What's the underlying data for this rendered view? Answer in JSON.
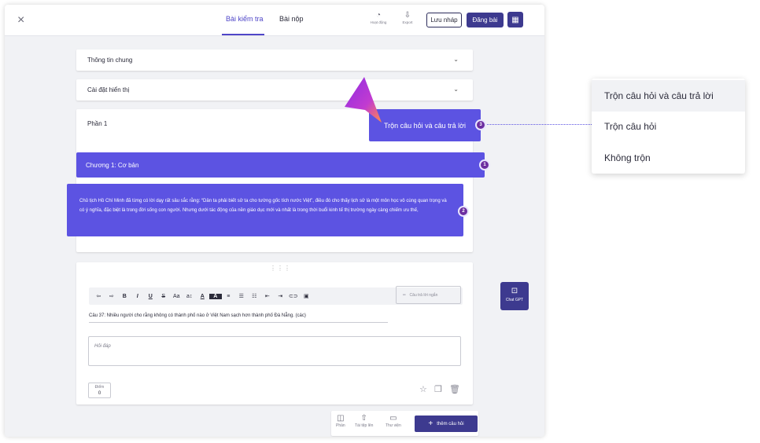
{
  "topbar": {
    "close_icon": "×",
    "tabs": [
      {
        "label": "Bài kiểm tra",
        "active": true
      },
      {
        "label": "Bài nộp",
        "active": false
      }
    ],
    "tools": [
      {
        "label": "Hoạt động",
        "icon": "activity-icon"
      },
      {
        "label": "Export",
        "icon": "export-icon"
      }
    ],
    "draft_label": "Lưu nháp",
    "post_label": "Đăng bài"
  },
  "sections": {
    "general": "Thông tin chung",
    "display": "Cài đặt hiển thị",
    "part": "Phần 1"
  },
  "shuffle_tag": "Trộn câu hỏi và câu trả lời",
  "chapter": "Chương 1: Cơ bản",
  "content_text": "Chủ tịch Hồ Chí Minh đã từng có lời dạy rất sâu sắc rằng: “Dân ta phải biết sử ta cho tường gốc tích nước Việt”, điều đó cho thấy lịch sử là một môn học vô cùng quan trọng và có ý nghĩa, đặc biệt là trong đời sống con người. Nhưng dưới tác động của nền giáo dục mới và nhất là trong thời buổi kinh tế thị trường ngày càng chiếm ưu thế,",
  "badges": {
    "one": "1",
    "two": "2",
    "three": "3"
  },
  "editor": {
    "toolbar": [
      "⇦",
      "⇨",
      "B",
      "I",
      "U",
      "S",
      "Aa",
      "a↕",
      "A",
      "A",
      "≡",
      "☰",
      "☷",
      "⇤",
      "⇥",
      "⊂⊃",
      "▣"
    ],
    "short_answer_placeholder": "Câu trả lời ngắn",
    "question": "Câu 37: Nhiều người cho rằng không có thành phố nào ở Việt Nam sạch hơn thành phố Đà Nẵng. (các)",
    "answer_placeholder": "Hỏi đáp",
    "score_label": "Điểm",
    "score_value": "0"
  },
  "bottom_bar": {
    "items": [
      {
        "label": "Phần",
        "icon": "section-icon"
      },
      {
        "label": "Tài tệp lên",
        "icon": "upload-icon"
      },
      {
        "label": "Thư viện",
        "icon": "folder-icon"
      }
    ],
    "add_label": "thêm câu hỏi"
  },
  "chat_gpt_label": "Chat GPT",
  "dropdown": {
    "options": [
      {
        "label": "Trộn câu hỏi và câu trả lời",
        "selected": true
      },
      {
        "label": "Trộn câu hỏi",
        "selected": false
      },
      {
        "label": "Không trộn",
        "selected": false
      }
    ]
  },
  "colors": {
    "accent": "#5c53e2",
    "primary_button": "#3d3a8f",
    "badge": "#6c2ea0"
  }
}
